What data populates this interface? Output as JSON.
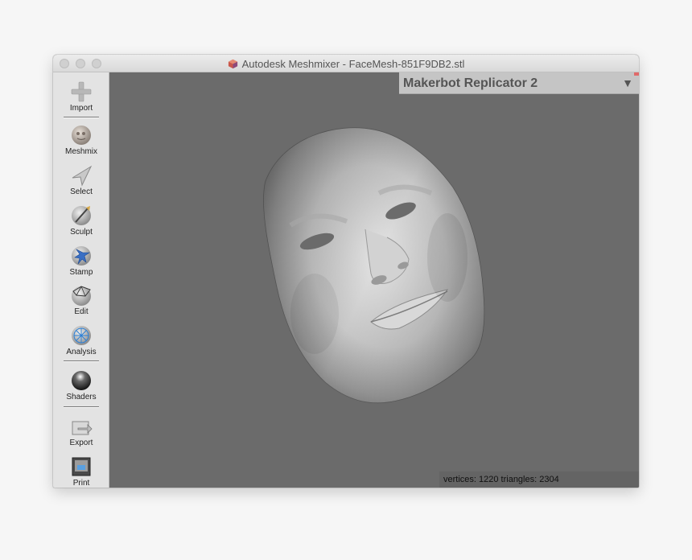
{
  "window": {
    "title": "Autodesk Meshmixer - FaceMesh-851F9DB2.stl"
  },
  "toolbar": {
    "items": [
      {
        "label": "Import",
        "icon": "plus-icon"
      },
      {
        "label": "Meshmix",
        "icon": "meshmix-icon"
      },
      {
        "label": "Select",
        "icon": "select-arrow-icon"
      },
      {
        "label": "Sculpt",
        "icon": "sculpt-brush-icon"
      },
      {
        "label": "Stamp",
        "icon": "stamp-icon"
      },
      {
        "label": "Edit",
        "icon": "edit-icon"
      },
      {
        "label": "Analysis",
        "icon": "analysis-icon"
      },
      {
        "label": "Shaders",
        "icon": "shaders-icon"
      },
      {
        "label": "Export",
        "icon": "export-icon"
      },
      {
        "label": "Print",
        "icon": "print-icon"
      }
    ]
  },
  "printer": {
    "name": "Makerbot Replicator 2",
    "arrow": "▼"
  },
  "status": {
    "text": "vertices: 1220 triangles: 2304"
  },
  "colors": {
    "viewport": "#6b6b6b",
    "toolbar": "#e3e3e3",
    "printer_bar": "#c5c5c5"
  }
}
